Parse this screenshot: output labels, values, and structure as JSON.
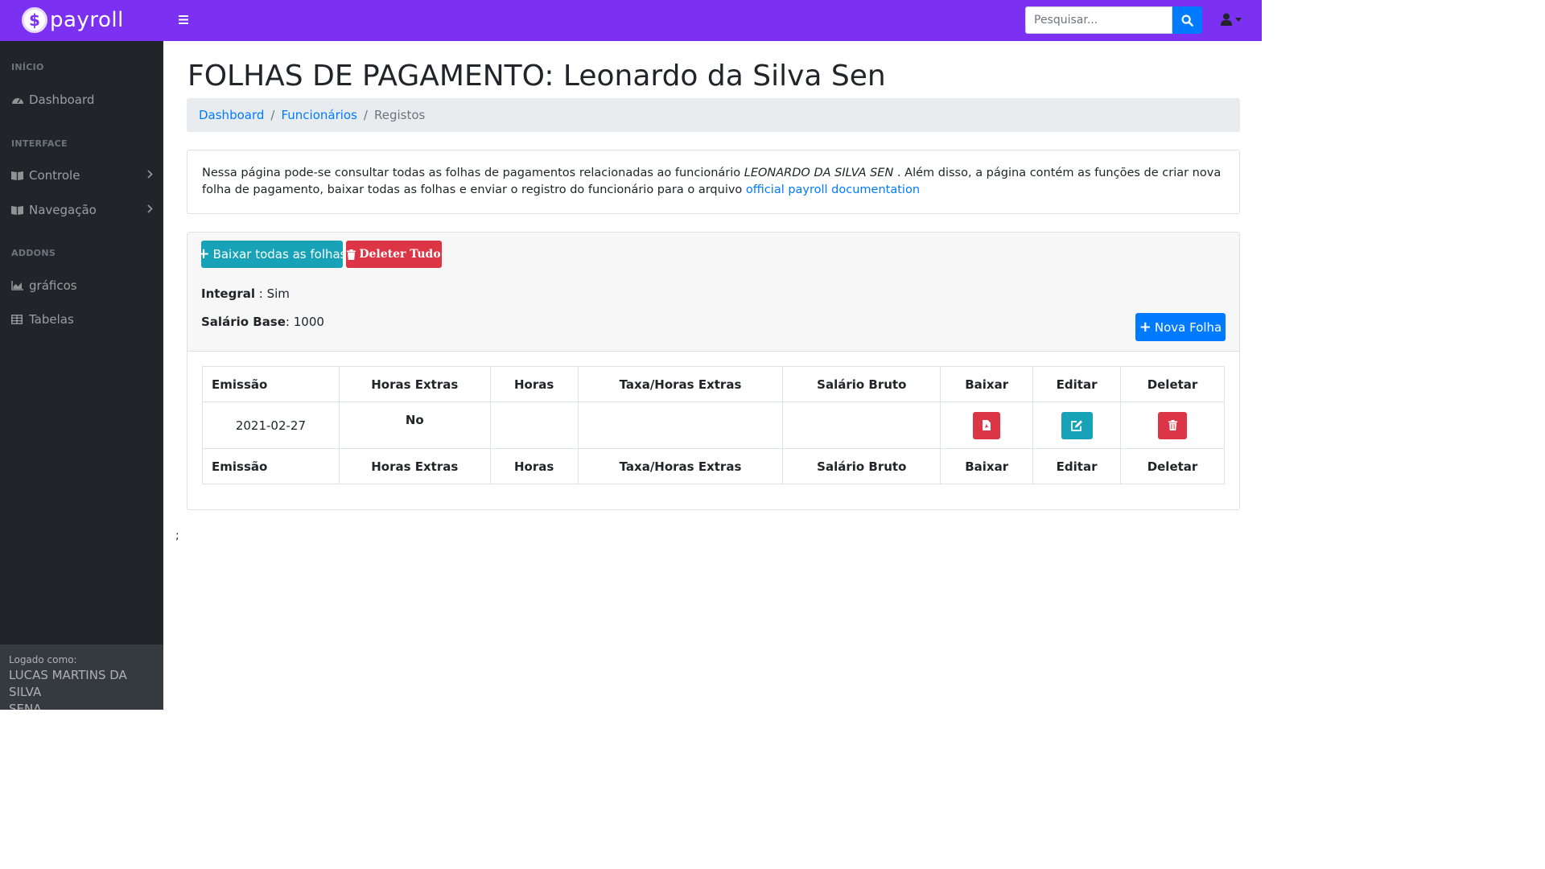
{
  "brand": {
    "name": "payroll",
    "coin_symbol": "$"
  },
  "search": {
    "placeholder": "Pesquisar..."
  },
  "colors": {
    "navbar": "#7c31f2",
    "sidebar": "#212529",
    "primary": "#007bff",
    "info": "#17a2b8",
    "danger": "#dc3545"
  },
  "sidebar": {
    "headings": [
      "INÍCIO",
      "INTERFACE",
      "ADDONS"
    ],
    "items": [
      {
        "label": "Dashboard",
        "icon": "tachometer-icon"
      },
      {
        "label": "Controle",
        "icon": "book-icon",
        "has_submenu": true
      },
      {
        "label": "Navegação",
        "icon": "book-icon",
        "has_submenu": true
      },
      {
        "label": "gráficos",
        "icon": "area-chart-icon"
      },
      {
        "label": "Tabelas",
        "icon": "table-icon"
      }
    ],
    "footer": {
      "caption": "Logado como:",
      "user_line1": "LUCAS MARTINS DA SILVA",
      "user_line2": "SENA"
    }
  },
  "page": {
    "title": "FOLHAS DE PAGAMENTO: Leonardo da Silva Sen",
    "breadcrumb": [
      "Dashboard",
      "Funcionários",
      "Registos"
    ],
    "separator": "/"
  },
  "info": {
    "text_before": "Nessa página pode-se consultar todas as folhas de pagamentos relacionadas ao funcionário ",
    "employee": "LEONARDO DA SILVA SEN",
    "text_after": " . Além disso, a página contém as funções de criar nova folha de pagamento, baixar todas as folhas e enviar o registro do funcionário para o arquivo ",
    "link": "official payroll documentation"
  },
  "panel": {
    "download_all": "Baixar todas as folhas",
    "delete_all": "Deleter Tudo",
    "new_sheet": "Nova Folha",
    "integral_label": "Integral",
    "integral_value": " : Sim",
    "salary_label": "Salário Base",
    "salary_value": ": 1000"
  },
  "table": {
    "headers": [
      "Emissão",
      "Horas Extras",
      "Horas",
      "Taxa/Horas Extras",
      "Salário Bruto",
      "Baixar",
      "Editar",
      "Deletar"
    ],
    "rows": [
      {
        "emissao": "2021-02-27",
        "horas_extras": "No",
        "horas": "",
        "taxa": "",
        "salario_bruto": ""
      }
    ]
  },
  "stray_text": ";"
}
